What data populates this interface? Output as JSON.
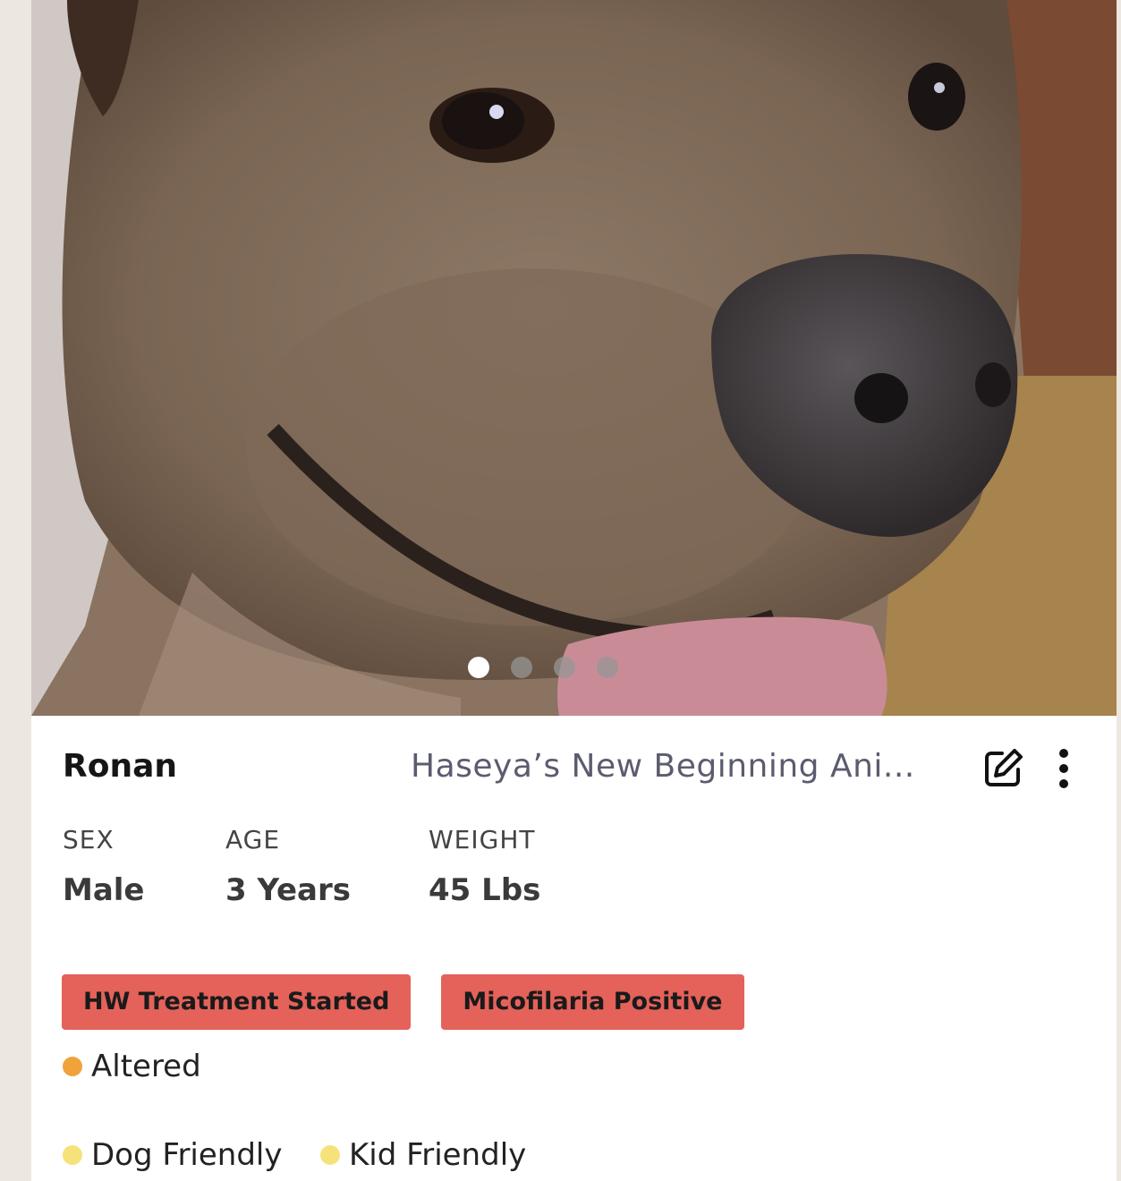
{
  "pet": {
    "name": "Ronan",
    "organization": "Haseya’s New Beginning Ani..."
  },
  "carousel": {
    "photo_count": 4,
    "active_index": 0
  },
  "stats": {
    "sex": {
      "label": "SEX",
      "value": "Male"
    },
    "age": {
      "label": "AGE",
      "value": "3 Years"
    },
    "weight": {
      "label": "WEIGHT",
      "value": "45 Lbs"
    }
  },
  "tags": [
    "HW Treatment Started",
    "Micofilaria Positive"
  ],
  "traits": {
    "altered": "Altered",
    "dog_friendly": "Dog Friendly",
    "kid_friendly": "Kid Friendly"
  },
  "colors": {
    "tag_background": "#e4625a",
    "altered_bullet": "#f0a23b",
    "friendly_bullet": "#f6e27a"
  },
  "icons": {
    "edit": "edit-icon",
    "more": "more-vertical-icon"
  }
}
